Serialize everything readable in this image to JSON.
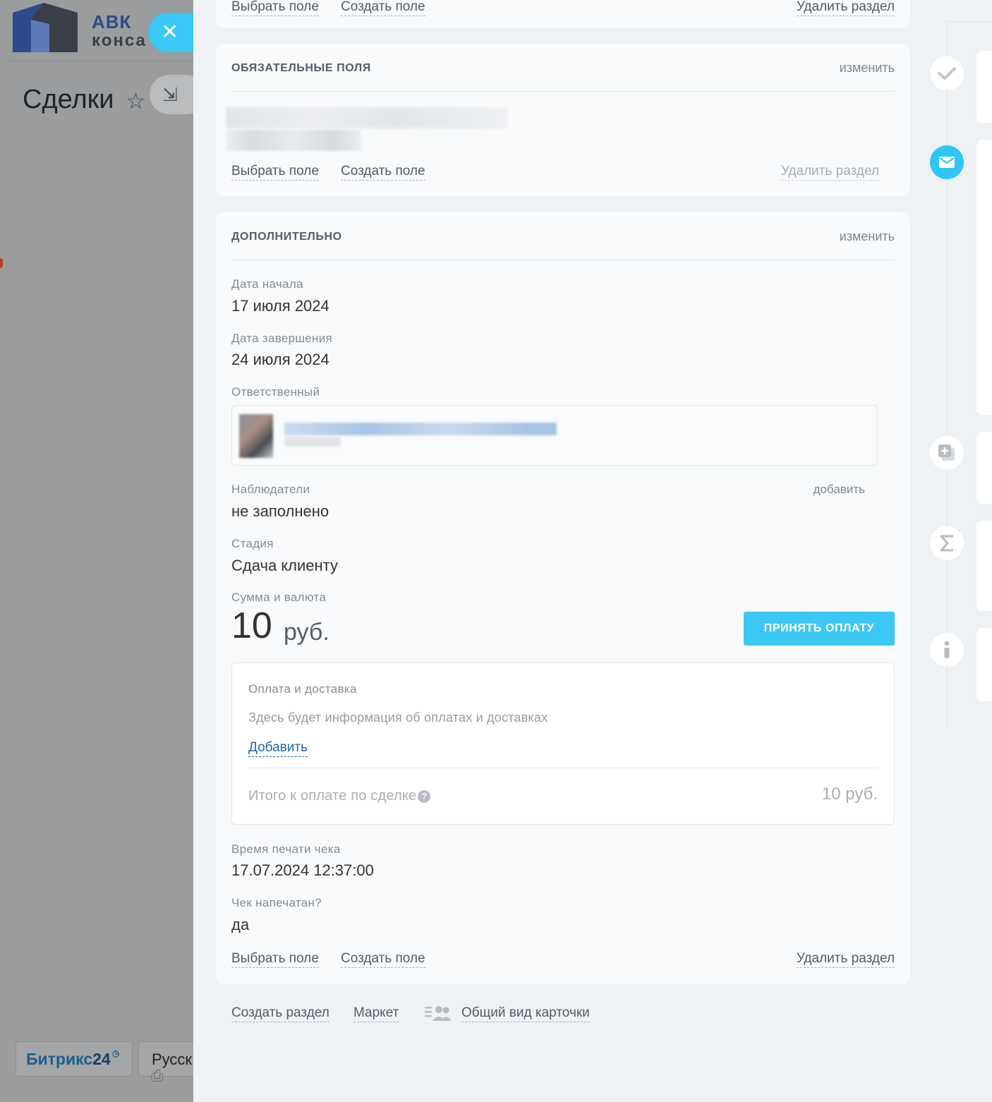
{
  "background": {
    "logo": {
      "line1": "АВК",
      "line2": "конса"
    },
    "page_title": "Сделки",
    "bitrix": {
      "name": "Битрикс",
      "number": "24",
      "clock": "◷"
    },
    "language": "Русск"
  },
  "slider": {
    "top_card": {
      "select_field": "Выбрать поле",
      "create_field": "Создать поле",
      "delete_section": "Удалить раздел"
    },
    "required_section": {
      "title": "ОБЯЗАТЕЛЬНЫЕ ПОЛЯ",
      "edit": "изменить",
      "select_field": "Выбрать поле",
      "create_field": "Создать поле",
      "delete_section": "Удалить раздел"
    },
    "additional_section": {
      "title": "ДОПОЛНИТЕЛЬНО",
      "edit": "изменить",
      "fields": {
        "start_date": {
          "label": "Дата начала",
          "value": "17 июля 2024"
        },
        "end_date": {
          "label": "Дата завершения",
          "value": "24 июля 2024"
        },
        "responsible": {
          "label": "Ответственный"
        },
        "observers": {
          "label": "Наблюдатели",
          "value": "не заполнено",
          "add": "добавить"
        },
        "stage": {
          "label": "Стадия",
          "value": "Сдача клиенту"
        },
        "amount": {
          "label": "Сумма и валюта",
          "value": "10",
          "currency": "руб.",
          "pay_button": "ПРИНЯТЬ ОПЛАТУ"
        },
        "payment": {
          "title": "Оплата и доставка",
          "info": "Здесь будет информация об оплатах и доставках",
          "add": "Добавить",
          "total_label": "Итого к оплате по сделке",
          "total_value": "10 руб."
        },
        "receipt_time": {
          "label": "Время печати чека",
          "value": "17.07.2024 12:37:00"
        },
        "receipt_printed": {
          "label": "Чек напечатан?",
          "value": "да"
        }
      },
      "select_field": "Выбрать поле",
      "create_field": "Создать поле",
      "delete_section": "Удалить раздел"
    },
    "bottom_links": {
      "create_section": "Создать раздел",
      "market": "Маркет",
      "common_view": "Общий вид карточки"
    }
  },
  "colors": {
    "accent": "#3bc8f5",
    "mail": "#2fc6f6",
    "link": "#2067b0"
  },
  "rail_icons": [
    "check-icon",
    "mail-icon",
    "add-copy-icon",
    "sum-icon",
    "info-icon"
  ]
}
